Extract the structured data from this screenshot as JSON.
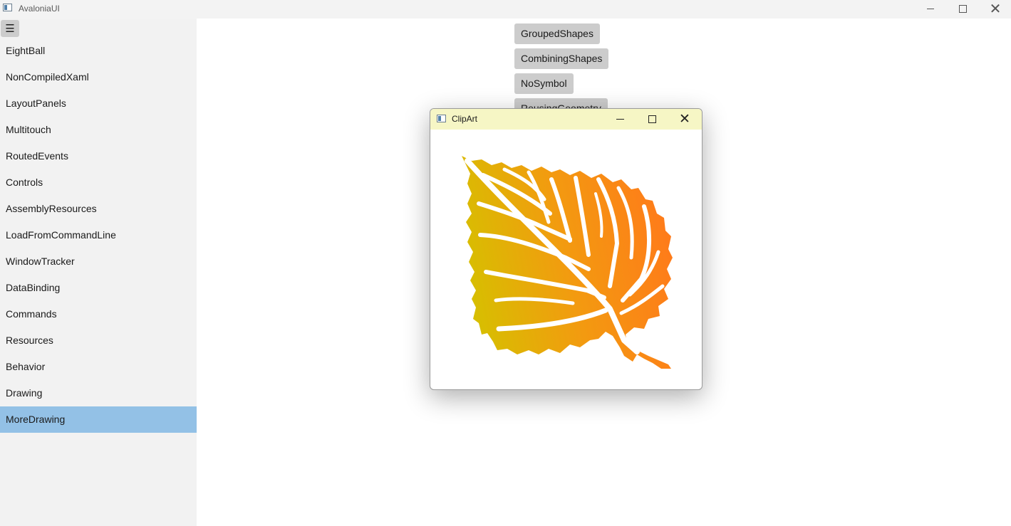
{
  "window": {
    "title": "AvaloniaUI",
    "icon": "app-window-icon",
    "controls": {
      "minimize": "minimize-icon",
      "maximize": "maximize-icon",
      "close": "close-icon"
    }
  },
  "sidebar": {
    "menu_button_glyph": "☰",
    "items": [
      {
        "label": "EightBall"
      },
      {
        "label": "NonCompiledXaml"
      },
      {
        "label": "LayoutPanels"
      },
      {
        "label": "Multitouch"
      },
      {
        "label": "RoutedEvents"
      },
      {
        "label": "Controls"
      },
      {
        "label": "AssemblyResources"
      },
      {
        "label": "LoadFromCommandLine"
      },
      {
        "label": "WindowTracker"
      },
      {
        "label": "DataBinding"
      },
      {
        "label": "Commands"
      },
      {
        "label": "Resources"
      },
      {
        "label": "Behavior"
      },
      {
        "label": "Drawing"
      },
      {
        "label": "MoreDrawing",
        "selected": true
      }
    ],
    "selected_color": "#93c1e6"
  },
  "content": {
    "buttons": [
      {
        "label": "GroupedShapes"
      },
      {
        "label": "CombiningShapes"
      },
      {
        "label": "NoSymbol"
      },
      {
        "label": "ReusingGeometry"
      }
    ]
  },
  "dialog": {
    "title": "ClipArt",
    "titlebar_color": "#f6f6c5",
    "image": "autumn-leaf-clipart",
    "leaf_gradient": [
      "#d6c000",
      "#f39a10",
      "#ff7a1a"
    ]
  }
}
